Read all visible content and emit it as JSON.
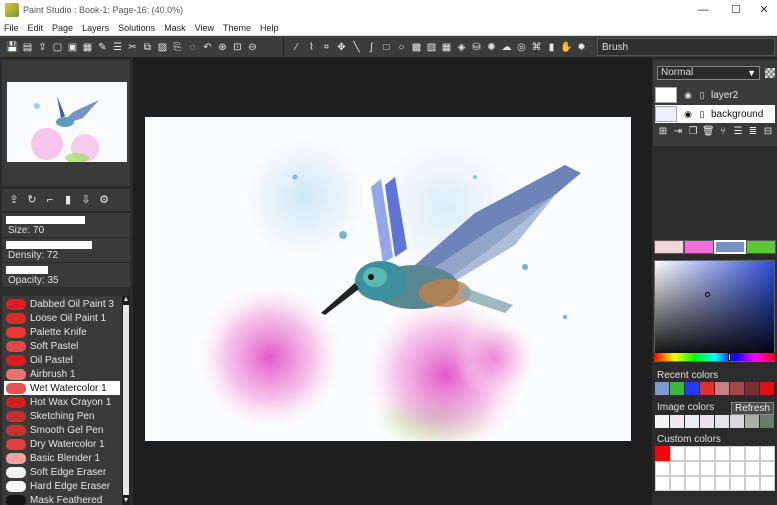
{
  "window": {
    "title": "Paint Studio : Book-1: Page-16: (40.0%)",
    "minimize": "—",
    "maximize": "☐",
    "close": "✕"
  },
  "menu": [
    "File",
    "Edit",
    "Page",
    "Layers",
    "Solutions",
    "Mask",
    "View",
    "Theme",
    "Help"
  ],
  "toolbar": {
    "left_icons": [
      "save-icon",
      "save-as-icon",
      "export-icon",
      "page-icon",
      "document-icon",
      "page-settings-icon",
      "brush-tool-icon",
      "list-icon",
      "scissors-icon",
      "copy-icon",
      "paste-icon",
      "clone-icon",
      "lasso-icon",
      "undo-icon",
      "zoom-in-icon",
      "fit-icon",
      "zoom-out-icon"
    ],
    "right_icons": [
      "pen-icon",
      "eyedropper-icon",
      "crop-icon",
      "move-icon",
      "line-icon",
      "curve-icon",
      "rectangle-icon",
      "ellipse-icon",
      "fill-icon",
      "gradient-icon",
      "pattern-icon",
      "texture-icon",
      "stamp-icon",
      "sparkle-icon",
      "smudge-icon",
      "lens-icon",
      "text-tool-icon",
      "eraser-icon",
      "hand-icon",
      "settings-icon"
    ],
    "brush_label": "Brush"
  },
  "brush_settings": {
    "size_label": "Size: 70",
    "size_value": 70,
    "density_label": "Density: 72",
    "density_value": 72,
    "opacity_label": "Opacity: 35",
    "opacity_value": 35
  },
  "brushes": [
    {
      "name": "Dabbed Oil Paint 3",
      "color": "#d42323"
    },
    {
      "name": "Loose Oil Paint 1",
      "color": "#e02a2a"
    },
    {
      "name": "Palette Knife",
      "color": "#e83838"
    },
    {
      "name": "Soft Pastel",
      "color": "#e34848"
    },
    {
      "name": "Oil Pastel",
      "color": "#d41d1d"
    },
    {
      "name": "Airbrush 1",
      "color": "#f07070"
    },
    {
      "name": "Wet Watercolor 1",
      "color": "#e85050",
      "selected": true
    },
    {
      "name": "Hot Wax Crayon 1",
      "color": "#d02020"
    },
    {
      "name": "Sketching Pen",
      "color": "#c43030"
    },
    {
      "name": "Smooth Gel Pen",
      "color": "#c83232"
    },
    {
      "name": "Dry Watercolor 1",
      "color": "#e04040"
    },
    {
      "name": "Basic Blender 1",
      "color": "#f4a0a0"
    },
    {
      "name": "Soft Edge Eraser",
      "color": "#f2f2f2"
    },
    {
      "name": "Hard Edge Eraser",
      "color": "#f6f6f6"
    },
    {
      "name": "Mask Feathered",
      "color": "#111111"
    }
  ],
  "layers": {
    "blend_mode": "Normal",
    "items": [
      {
        "name": "layer2",
        "active": false
      },
      {
        "name": "background",
        "active": true
      }
    ]
  },
  "colors": {
    "top_swatches": [
      "#f4d2dc",
      "#f06ee0",
      "#7690c8",
      "#5cc838"
    ],
    "selected_swatch": 2,
    "recent_label": "Recent colors",
    "recent": [
      "#7b9ad0",
      "#3cb83c",
      "#1e3cff",
      "#e03030",
      "#c88080",
      "#a04848",
      "#7a3030",
      "#e01010"
    ],
    "image_label": "Image colors",
    "refresh_label": "Refresh",
    "image": [
      "#f4f4f4",
      "#f0eaf0",
      "#e8eef4",
      "#ece4ec",
      "#e4e4e8",
      "#dcd8e0",
      "#a8b0a8",
      "#6a7c6c"
    ],
    "custom_label": "Custom colors",
    "custom_first": "#ff0000"
  }
}
